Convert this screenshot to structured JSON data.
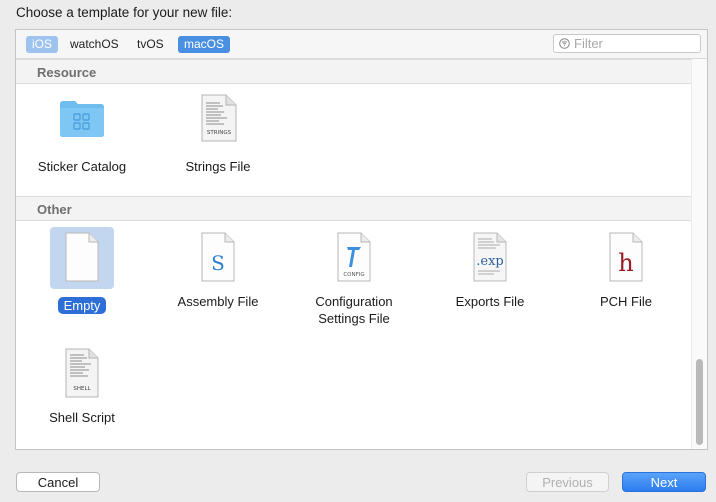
{
  "dialog": {
    "title": "Choose a template for your new file:"
  },
  "platforms": [
    {
      "label": "iOS"
    },
    {
      "label": "watchOS"
    },
    {
      "label": "tvOS"
    },
    {
      "label": "macOS"
    }
  ],
  "filter": {
    "placeholder": "Filter",
    "value": ""
  },
  "sections": [
    {
      "title": "Resource",
      "items": [
        {
          "label": "Sticker Catalog",
          "icon": "sticker-catalog-folder-icon"
        },
        {
          "label": "Strings File",
          "icon": "strings-file-icon",
          "badge": "STRINGS"
        }
      ]
    },
    {
      "title": "Other",
      "items": [
        {
          "label": "Empty",
          "icon": "empty-file-icon",
          "selected": true
        },
        {
          "label": "Assembly File",
          "icon": "assembly-file-icon",
          "glyph": "S"
        },
        {
          "label_line1": "Configuration",
          "label_line2": "Settings File",
          "icon": "config-file-icon",
          "badge": "CONFIG"
        },
        {
          "label": "Exports File",
          "icon": "exports-file-icon",
          "glyph": ".exp"
        },
        {
          "label": "PCH File",
          "icon": "pch-file-icon",
          "glyph": "h"
        },
        {
          "label": "Shell Script",
          "icon": "shell-script-icon",
          "badge": "SHELL"
        }
      ]
    }
  ],
  "buttons": {
    "cancel": "Cancel",
    "previous": "Previous",
    "next": "Next"
  },
  "colors": {
    "accent": "#2d6fd7",
    "selection_bg": "#c3d6f0",
    "folder": "#6fbcef",
    "pch_red": "#9b1b25"
  }
}
